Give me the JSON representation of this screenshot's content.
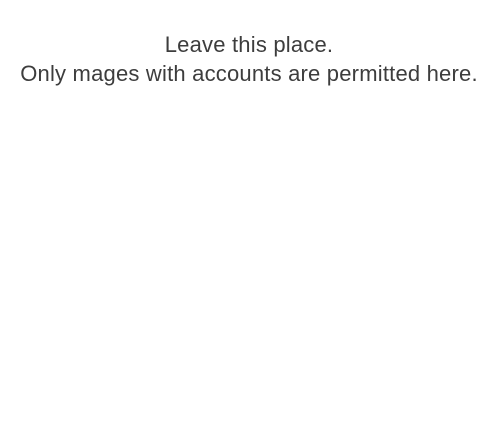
{
  "message": {
    "line1": "Leave this place.",
    "line2": "Only mages with accounts are permitted here."
  }
}
